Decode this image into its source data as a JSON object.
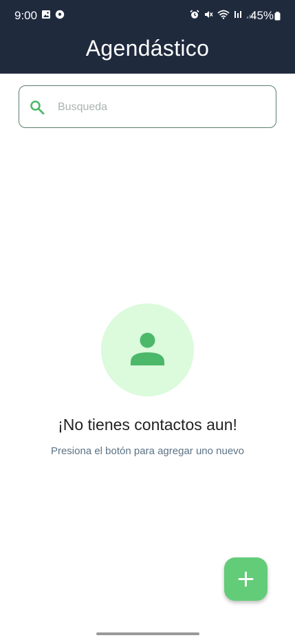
{
  "status_bar": {
    "time": "9:00",
    "battery": "45%"
  },
  "header": {
    "title": "Agendástico"
  },
  "search": {
    "placeholder": "Busqueda",
    "value": ""
  },
  "empty_state": {
    "title": "¡No tienes contactos aun!",
    "subtitle": "Presiona el botón para agregar uno nuevo"
  },
  "colors": {
    "header_bg": "#1f2a3d",
    "accent_green": "#63cc78",
    "avatar_bg": "#dcfadc",
    "icon_green": "#4cb86a"
  },
  "icons": {
    "search": "search-icon",
    "person": "person-icon",
    "fab": "plus-icon"
  }
}
